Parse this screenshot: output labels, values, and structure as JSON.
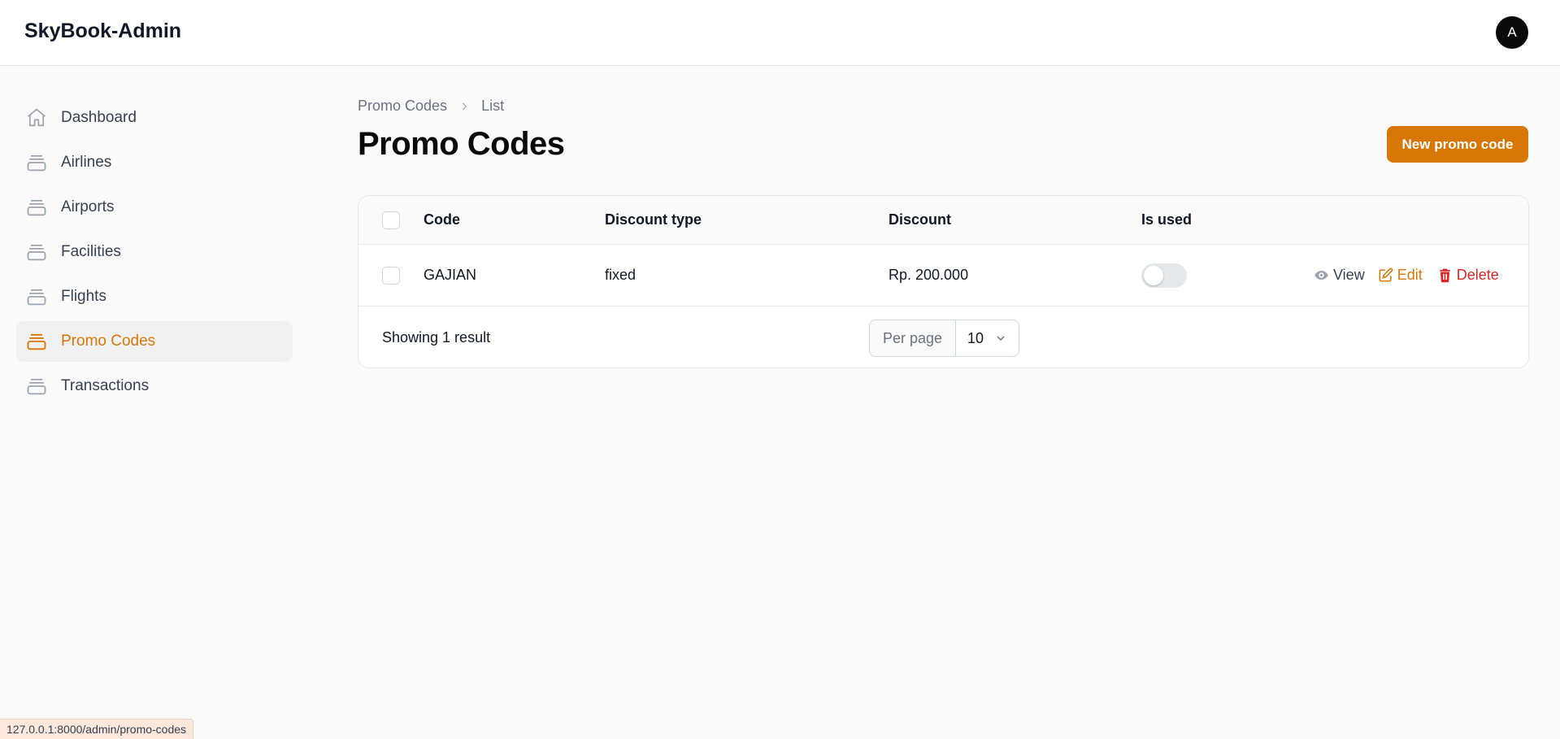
{
  "app": {
    "brand": "SkyBook-Admin",
    "avatar_initial": "A"
  },
  "sidebar": {
    "items": [
      {
        "label": "Dashboard",
        "icon": "home-icon",
        "active": false
      },
      {
        "label": "Airlines",
        "icon": "stack-icon",
        "active": false
      },
      {
        "label": "Airports",
        "icon": "stack-icon",
        "active": false
      },
      {
        "label": "Facilities",
        "icon": "stack-icon",
        "active": false
      },
      {
        "label": "Flights",
        "icon": "stack-icon",
        "active": false
      },
      {
        "label": "Promo Codes",
        "icon": "stack-icon",
        "active": true
      },
      {
        "label": "Transactions",
        "icon": "stack-icon",
        "active": false
      }
    ]
  },
  "breadcrumb": {
    "items": [
      "Promo Codes",
      "List"
    ]
  },
  "page": {
    "title": "Promo Codes",
    "new_button": "New promo code"
  },
  "table": {
    "columns": [
      "Code",
      "Discount type",
      "Discount",
      "Is used"
    ],
    "rows": [
      {
        "code": "GAJIAN",
        "discount_type": "fixed",
        "discount": "Rp. 200.000",
        "is_used": false
      }
    ],
    "actions": {
      "view": "View",
      "edit": "Edit",
      "delete": "Delete"
    },
    "footer": {
      "summary": "Showing 1 result",
      "per_page_label": "Per page",
      "per_page_value": "10"
    }
  },
  "statusbar": {
    "url": "127.0.0.1:8000/admin/promo-codes"
  },
  "colors": {
    "accent": "#d97706",
    "danger": "#dc2626",
    "muted": "#6b7280",
    "avatar": "#0a0a0a"
  }
}
